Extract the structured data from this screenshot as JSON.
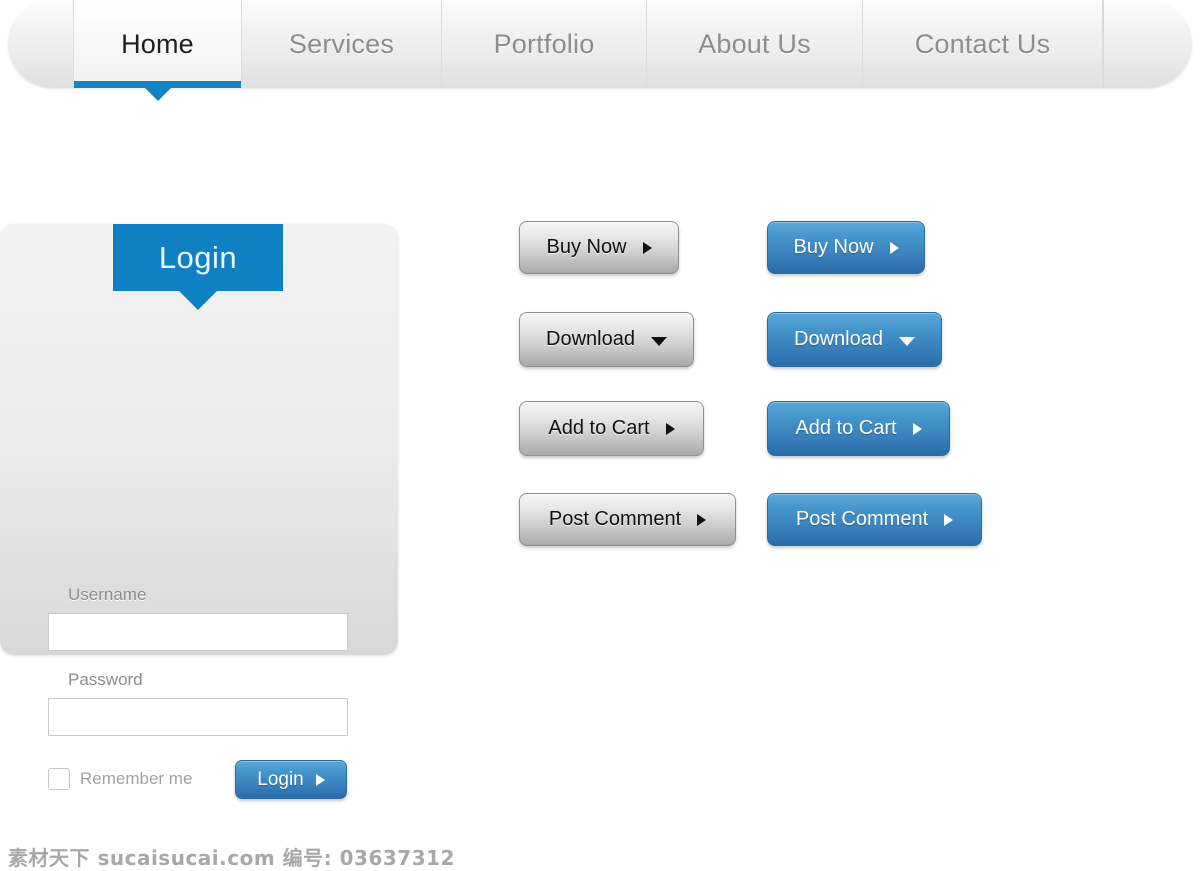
{
  "nav": {
    "tabs": [
      {
        "label": "Home",
        "active": true
      },
      {
        "label": "Services",
        "active": false
      },
      {
        "label": "Portfolio",
        "active": false
      },
      {
        "label": "About Us",
        "active": false
      },
      {
        "label": "Contact Us",
        "active": false
      }
    ],
    "accent_color": "#1482c4"
  },
  "login": {
    "title": "Login",
    "username_label": "Username",
    "password_label": "Password",
    "username_value": "",
    "password_value": "",
    "username_placeholder": "",
    "password_placeholder": "",
    "remember_label": "Remember me",
    "remember_checked": false,
    "submit_label": "Login",
    "submit_arrow": "arrow-right-icon",
    "header_color": "#0f80c2"
  },
  "watermark": {
    "text": "素材天下 sucaisucai.com 编号: 03637312"
  },
  "buttons": {
    "gray_style_color": "#cdcdcd",
    "blue_style_color": "#3a83be",
    "gray": [
      {
        "label": "Buy Now",
        "arrow": "arrow-right-icon"
      },
      {
        "label": "Download",
        "arrow": "arrow-down-icon"
      },
      {
        "label": "Add to Cart",
        "arrow": "arrow-right-icon"
      },
      {
        "label": "Post Comment",
        "arrow": "arrow-right-icon"
      }
    ],
    "blue": [
      {
        "label": "Buy Now",
        "arrow": "arrow-right-icon"
      },
      {
        "label": "Download",
        "arrow": "arrow-down-icon"
      },
      {
        "label": "Add to Cart",
        "arrow": "arrow-right-icon"
      },
      {
        "label": "Post Comment",
        "arrow": "arrow-right-icon"
      }
    ]
  }
}
